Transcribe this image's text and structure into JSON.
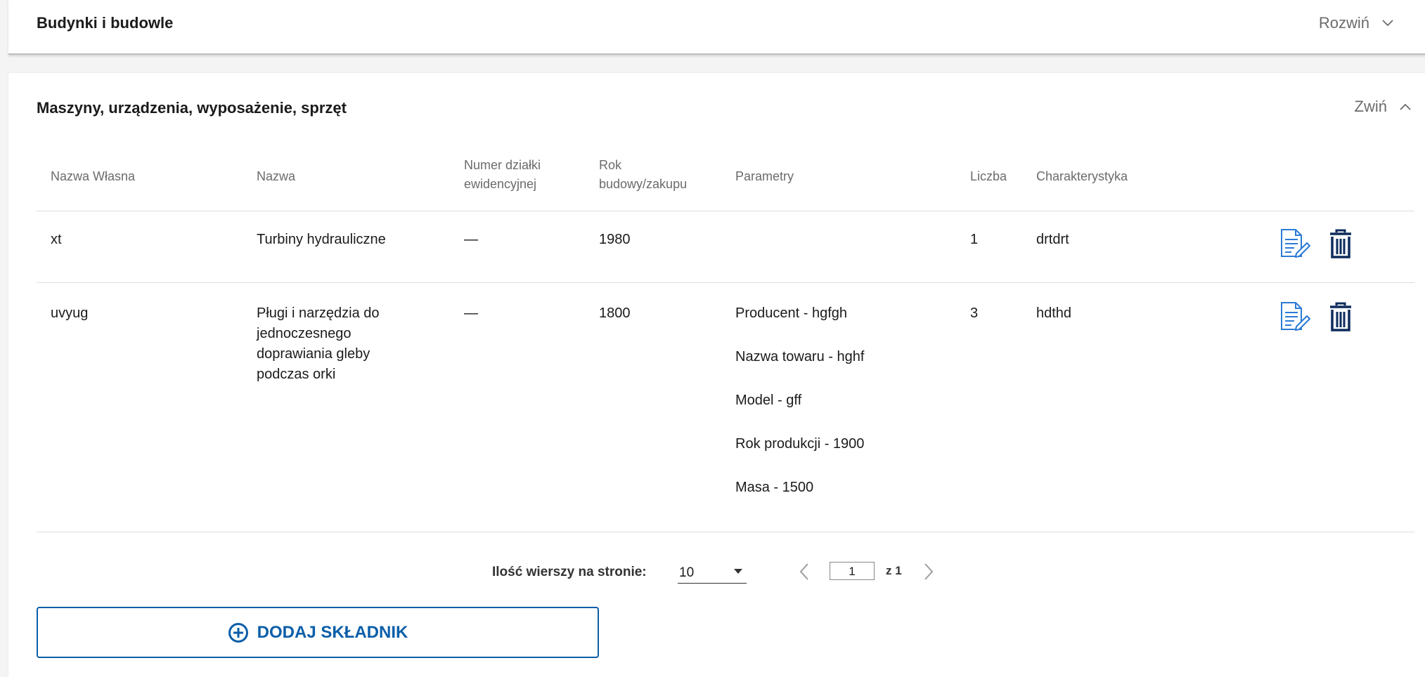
{
  "sections": [
    {
      "title": "Budynki i budowle",
      "toggle_label": "Rozwiń"
    },
    {
      "title": "Maszyny, urządzenia, wyposażenie, sprzęt",
      "toggle_label": "Zwiń"
    }
  ],
  "table": {
    "headers": [
      "Nazwa Własna",
      "Nazwa",
      "Numer działki ewidencyjnej",
      "Rok budowy/zakupu",
      "Parametry",
      "Liczba",
      "Charakterystyka"
    ],
    "header_lines": {
      "numer": [
        "Numer działki",
        "ewidencyjnej"
      ],
      "rok": [
        "Rok",
        "budowy/zakupu"
      ]
    },
    "rows": [
      {
        "nazwa_wlasna": "xt",
        "nazwa": "Turbiny hydrauliczne",
        "numer_dzialki": "—",
        "rok": "1980",
        "parametry": [],
        "liczba": "1",
        "charakterystyka": "drtdrt"
      },
      {
        "nazwa_wlasna": "uvyug",
        "nazwa_lines": [
          "Pługi i narzędzia do",
          "jednoczesnego",
          "doprawiania gleby",
          "podczas orki"
        ],
        "numer_dzialki": "—",
        "rok": "1800",
        "parametry": [
          "Producent - hgfgh",
          "Nazwa towaru - hghf",
          "Model - gff",
          "Rok produkcji - 1900",
          "Masa - 1500"
        ],
        "liczba": "3",
        "charakterystyka": "hdthd"
      }
    ]
  },
  "pagination": {
    "rows_label": "Ilość wierszy na stronie:",
    "rows_value": "10",
    "page_value": "1",
    "of_label": "z 1"
  },
  "add_button": {
    "label": "DODAJ SKŁADNIK"
  },
  "icons": {
    "toggle_collapsed": "chevron-down-icon",
    "toggle_expanded": "chevron-up-icon",
    "edit": "edit-document-icon",
    "delete": "trash-icon",
    "add": "plus-circle-icon",
    "prev": "chevron-left-icon",
    "next": "chevron-right-icon"
  },
  "colors": {
    "accent": "#0b5ea8",
    "edit_icon": "#2b7bd6",
    "divider": "#dedede"
  }
}
